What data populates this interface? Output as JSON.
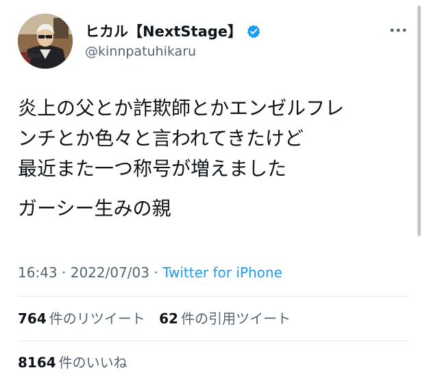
{
  "profile": {
    "display_name": "ヒカル【NextStage】",
    "handle": "@kinnpatuhikaru",
    "verified_icon": "verified-badge-icon",
    "avatar_icon": "profile-photo"
  },
  "tweet": {
    "lines": [
      "炎上の父とか詐欺師とかエンゼルフレ",
      "ンチとか色々と言われてきたけど",
      "最近また一つ称号が増えました",
      "ガーシー生みの親"
    ],
    "time": "16:43",
    "separator": "·",
    "date": "2022/07/03",
    "source": "Twitter for iPhone"
  },
  "stats": {
    "retweets": {
      "count": "764",
      "label": "件のリツイート"
    },
    "quotes": {
      "count": "62",
      "label": "件の引用ツイート"
    },
    "likes": {
      "count": "8164",
      "label": "件のいいね"
    }
  },
  "colors": {
    "link": "#1d9bf0",
    "secondary_text": "#536471",
    "primary_text": "#0f1419",
    "verified": "#1d9bf0"
  }
}
